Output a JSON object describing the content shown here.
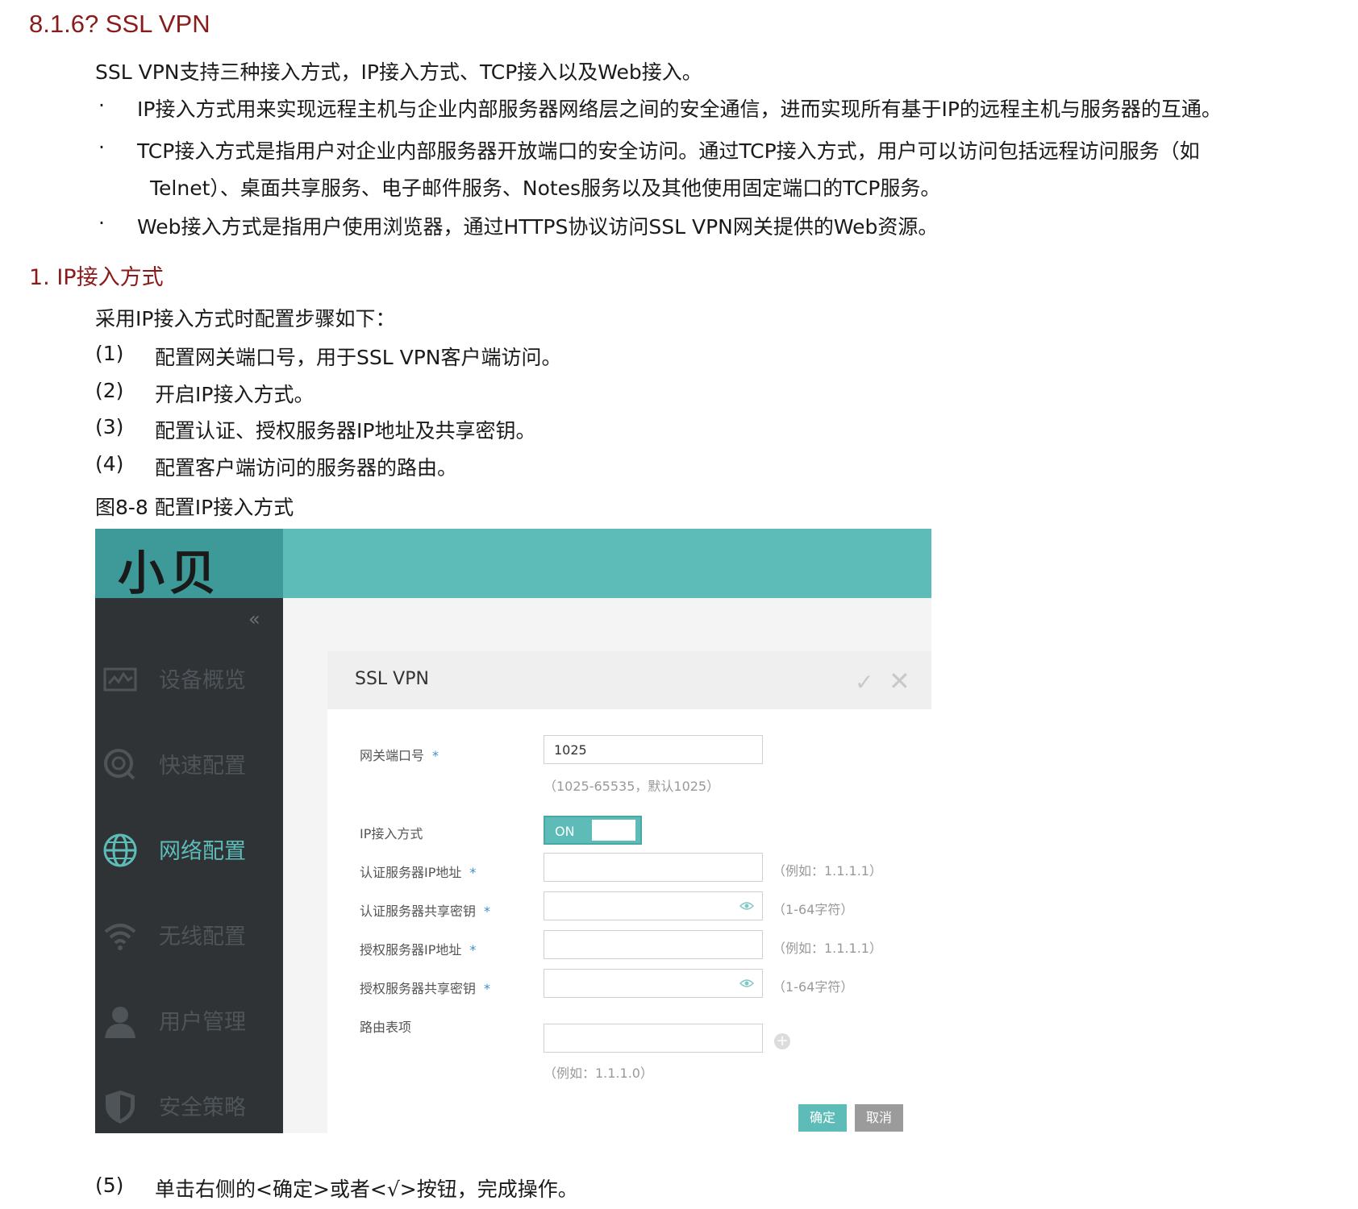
{
  "section_heading": "8.1.6? SSL VPN",
  "intro": "SSL VPN支持三种接入方式，IP接入方式、TCP接入以及Web接入。",
  "bullets": [
    {
      "dot": "·",
      "line1": "IP接入方式用来实现远程主机与企业内部服务器网络层之间的安全通信，进而实现所有基于IP的远程主机与服务器的互通。"
    },
    {
      "dot": "·",
      "line1": "TCP接入方式是指用户对企业内部服务器开放端口的安全访问。通过TCP接入方式，用户可以访问包括远程访问服务（如",
      "line2": "Telnet）、桌面共享服务、电子邮件服务、Notes服务以及其他使用固定端口的TCP服务。"
    },
    {
      "dot": "·",
      "line1": "Web接入方式是指用户使用浏览器，通过HTTPS协议访问SSL VPN网关提供的Web资源。"
    }
  ],
  "subheading": "1. IP接入方式",
  "steps_intro": "采用IP接入方式时配置步骤如下：",
  "steps": [
    {
      "num": "(1)",
      "text": "配置网关端口号，用于SSL VPN客户端访问。"
    },
    {
      "num": "(2)",
      "text": "开启IP接入方式。"
    },
    {
      "num": "(3)",
      "text": "配置认证、授权服务器IP地址及共享密钥。"
    },
    {
      "num": "(4)",
      "text": "配置客户端访问的服务器的路由。"
    }
  ],
  "figure_caption": "图8-8 配置IP接入方式",
  "final_step": {
    "num": "(5)",
    "text": "单击右侧的<确定>或者<√>按钮，完成操作。"
  },
  "figure": {
    "logo": "小贝",
    "collapse": "«",
    "nav": [
      {
        "label": "设备概览",
        "icon": "monitor-chart-icon",
        "active": false
      },
      {
        "label": "快速配置",
        "icon": "quick-config-icon",
        "active": false
      },
      {
        "label": "网络配置",
        "icon": "globe-icon",
        "active": true
      },
      {
        "label": "无线配置",
        "icon": "wifi-icon",
        "active": false
      },
      {
        "label": "用户管理",
        "icon": "user-icon",
        "active": false
      },
      {
        "label": "安全策略",
        "icon": "shield-icon",
        "active": false
      }
    ],
    "panel": {
      "title": "SSL VPN",
      "confirm_icon": "✓",
      "close_icon": "✕",
      "fields": {
        "gateway_port": {
          "label": "网关端口号",
          "required": "*",
          "value": "1025",
          "hint": "（1025-65535，默认1025）"
        },
        "ip_access": {
          "label": "IP接入方式",
          "state": "ON"
        },
        "auth_ip": {
          "label": "认证服务器IP地址",
          "required": "*",
          "value": "",
          "hint": "（例如：1.1.1.1）"
        },
        "auth_key": {
          "label": "认证服务器共享密钥",
          "required": "*",
          "value": "",
          "hint": "（1-64字符）"
        },
        "authz_ip": {
          "label": "授权服务器IP地址",
          "required": "*",
          "value": "",
          "hint": "（例如：1.1.1.1）"
        },
        "authz_key": {
          "label": "授权服务器共享密钥",
          "required": "*",
          "value": "",
          "hint": "（1-64字符）"
        },
        "route": {
          "label": "路由表项",
          "value": "",
          "hint": "（例如：1.1.1.0）",
          "add": "+"
        }
      },
      "ok_label": "确定",
      "cancel_label": "取消"
    }
  }
}
